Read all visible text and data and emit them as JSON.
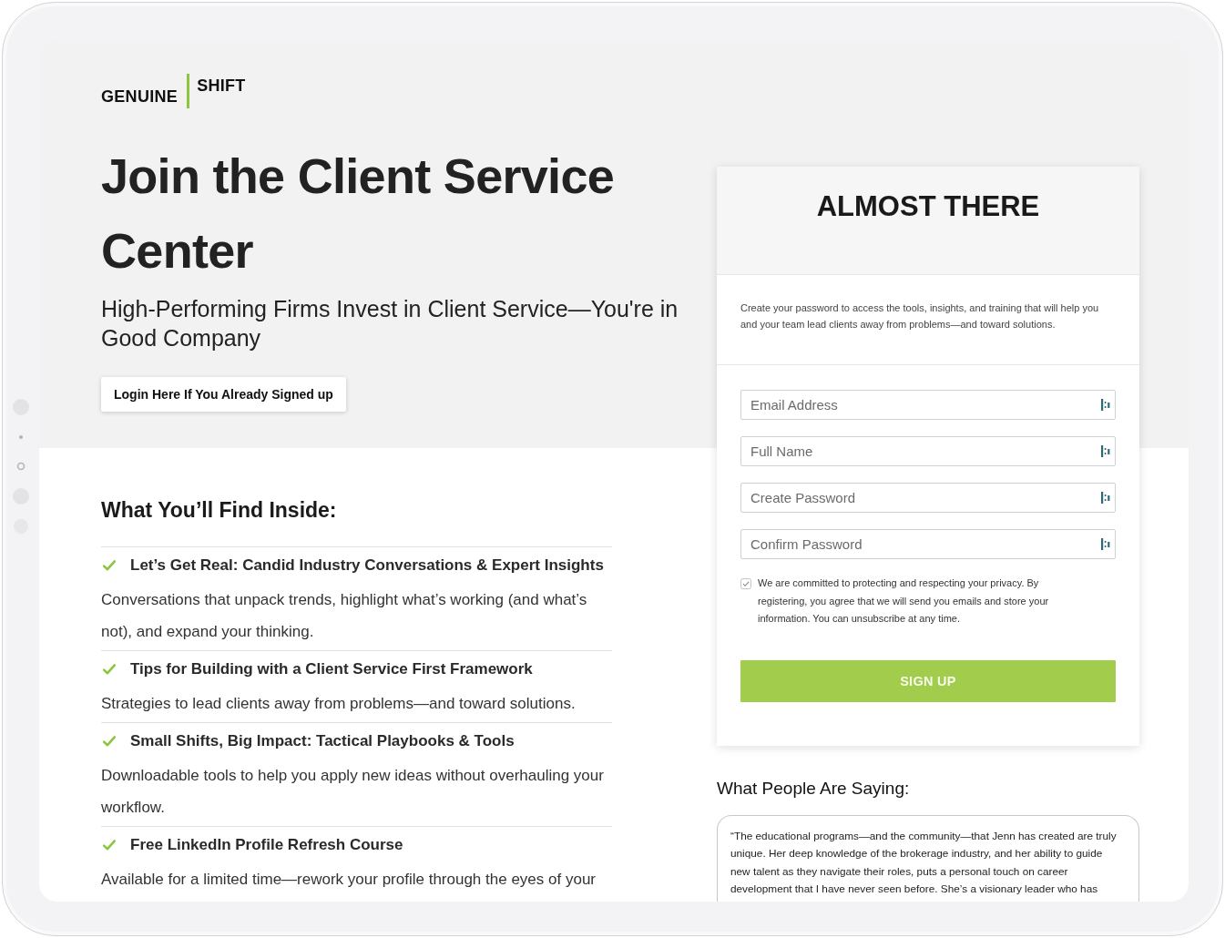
{
  "logo": {
    "primary": "GENUINE",
    "secondary": "SHIFT"
  },
  "hero": {
    "title": "Join the Client Service Center",
    "subtitle": "High-Performing Firms Invest in Client Service—You're in Good Company",
    "login_button": "Login Here If You Already Signed up"
  },
  "features": {
    "heading": "What You’ll Find Inside:",
    "items": [
      {
        "title": "Let’s Get Real: Candid Industry Conversations & Expert Insights",
        "description": "Conversations that unpack trends, highlight what’s working (and what’s not), and expand your thinking."
      },
      {
        "title": "Tips for Building with a Client Service First Framework",
        "description": "Strategies to lead clients away from problems—and toward solutions."
      },
      {
        "title": "Small Shifts, Big Impact: Tactical Playbooks & Tools",
        "description": "Downloadable tools to help you apply new ideas without overhauling your workflow."
      },
      {
        "title": "Free LinkedIn Profile Refresh Course",
        "description": "Available for a limited time—rework your profile through the eyes of your"
      }
    ]
  },
  "signup_form": {
    "title": "ALMOST THERE",
    "intro": "Create your password to access the tools, insights, and training that will help you and your team lead clients away from problems—and toward solutions.",
    "fields": [
      {
        "placeholder": "Email Address"
      },
      {
        "placeholder": "Full Name"
      },
      {
        "placeholder": "Create Password"
      },
      {
        "placeholder": "Confirm Password"
      }
    ],
    "consent": {
      "checked": true,
      "text": "We are committed to protecting and respecting your privacy. By registering, you agree that we will send you emails and store your information. You can unsubscribe at any time."
    },
    "submit_button": "SIGN UP"
  },
  "testimonials": {
    "heading": "What People Are Saying:",
    "quote": "“The educational programs—and the community—that Jenn has created are truly unique. Her deep knowledge of the brokerage industry, and her ability to guide new talent as they navigate their roles, puts a personal touch on career development that I have never seen before. She’s a visionary leader who has"
  }
}
